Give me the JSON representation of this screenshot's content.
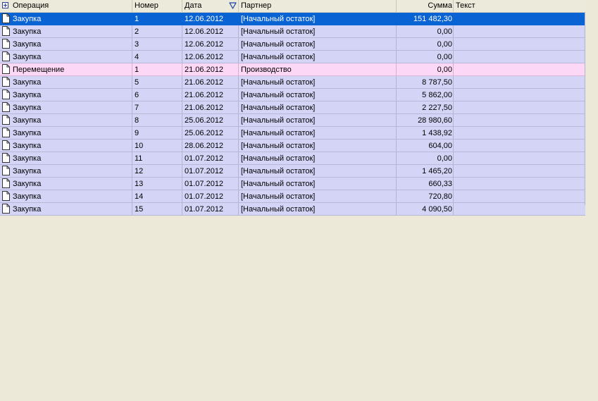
{
  "columns": {
    "operation": "Операция",
    "number": "Номер",
    "date": "Дата",
    "partner": "Партнер",
    "sum": "Сумма",
    "text": "Текст"
  },
  "icons": {
    "expand": "plus-box-icon",
    "sort": "sort-descending-icon",
    "row": "document-icon"
  },
  "colors": {
    "purchase_row": "#d4d4f7",
    "transfer_row": "#fdd7f6",
    "selected_row": "#0a63d3"
  },
  "rows": [
    {
      "operation": "Закупка",
      "number": "1",
      "date": "12.06.2012",
      "partner": "[Начальный остаток]",
      "sum": "151 482,30",
      "text": "",
      "kind": "selected"
    },
    {
      "operation": "Закупка",
      "number": "2",
      "date": "12.06.2012",
      "partner": "[Начальный остаток]",
      "sum": "0,00",
      "text": "",
      "kind": "purchase"
    },
    {
      "operation": "Закупка",
      "number": "3",
      "date": "12.06.2012",
      "partner": "[Начальный остаток]",
      "sum": "0,00",
      "text": "",
      "kind": "purchase"
    },
    {
      "operation": "Закупка",
      "number": "4",
      "date": "12.06.2012",
      "partner": "[Начальный остаток]",
      "sum": "0,00",
      "text": "",
      "kind": "purchase"
    },
    {
      "operation": "Перемещение",
      "number": "1",
      "date": "21.06.2012",
      "partner": "Производство",
      "sum": "0,00",
      "text": "",
      "kind": "move"
    },
    {
      "operation": "Закупка",
      "number": "5",
      "date": "21.06.2012",
      "partner": "[Начальный остаток]",
      "sum": "8 787,50",
      "text": "",
      "kind": "purchase"
    },
    {
      "operation": "Закупка",
      "number": "6",
      "date": "21.06.2012",
      "partner": "[Начальный остаток]",
      "sum": "5 862,00",
      "text": "",
      "kind": "purchase"
    },
    {
      "operation": "Закупка",
      "number": "7",
      "date": "21.06.2012",
      "partner": "[Начальный остаток]",
      "sum": "2 227,50",
      "text": "",
      "kind": "purchase"
    },
    {
      "operation": "Закупка",
      "number": "8",
      "date": "25.06.2012",
      "partner": "[Начальный остаток]",
      "sum": "28 980,60",
      "text": "",
      "kind": "purchase"
    },
    {
      "operation": "Закупка",
      "number": "9",
      "date": "25.06.2012",
      "partner": "[Начальный остаток]",
      "sum": "1 438,92",
      "text": "",
      "kind": "purchase"
    },
    {
      "operation": "Закупка",
      "number": "10",
      "date": "28.06.2012",
      "partner": "[Начальный остаток]",
      "sum": "604,00",
      "text": "",
      "kind": "purchase"
    },
    {
      "operation": "Закупка",
      "number": "11",
      "date": "01.07.2012",
      "partner": "[Начальный остаток]",
      "sum": "0,00",
      "text": "",
      "kind": "purchase"
    },
    {
      "operation": "Закупка",
      "number": "12",
      "date": "01.07.2012",
      "partner": "[Начальный остаток]",
      "sum": "1 465,20",
      "text": "",
      "kind": "purchase"
    },
    {
      "operation": "Закупка",
      "number": "13",
      "date": "01.07.2012",
      "partner": "[Начальный остаток]",
      "sum": "660,33",
      "text": "",
      "kind": "purchase"
    },
    {
      "operation": "Закупка",
      "number": "14",
      "date": "01.07.2012",
      "partner": "[Начальный остаток]",
      "sum": "720,80",
      "text": "",
      "kind": "purchase"
    },
    {
      "operation": "Закупка",
      "number": "15",
      "date": "01.07.2012",
      "partner": "[Начальный остаток]",
      "sum": "4 090,50",
      "text": "",
      "kind": "purchase"
    }
  ]
}
